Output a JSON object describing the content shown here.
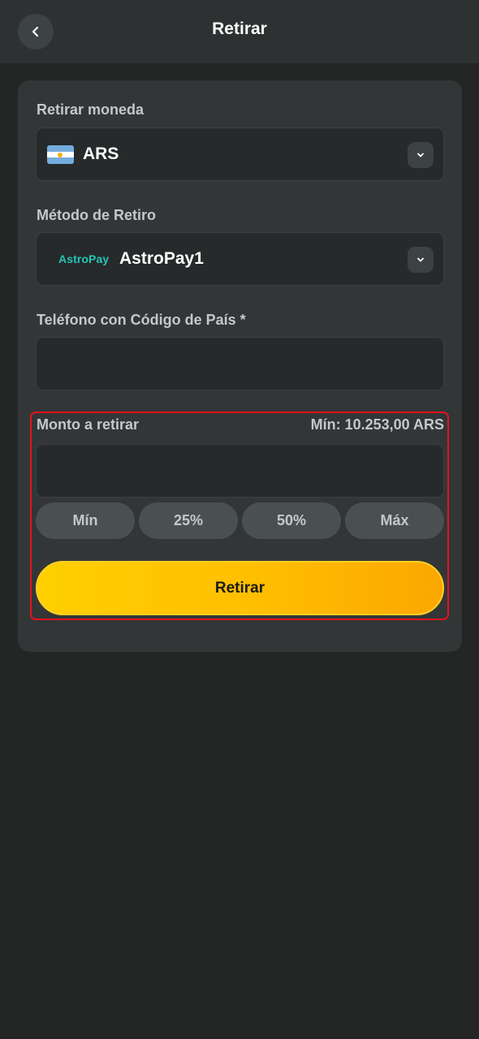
{
  "header": {
    "title": "Retirar",
    "back_icon": "chevron-left-icon"
  },
  "currency": {
    "label": "Retirar moneda",
    "value": "ARS",
    "flag_icon": "argentina-flag-icon"
  },
  "method": {
    "label": "Método de Retiro",
    "logo_text": "AstroPay",
    "value": "AstroPay1"
  },
  "phone": {
    "label": "Teléfono con Código de País *",
    "value": ""
  },
  "amount": {
    "label": "Monto a retirar",
    "min_text": "Mín: 10.253,00 ARS",
    "value": "",
    "quick_buttons": [
      "Mín",
      "25%",
      "50%",
      "Máx"
    ]
  },
  "submit_label": "Retirar",
  "colors": {
    "background": "#242626",
    "card": "#323637",
    "accent_yellow": "#ffc400",
    "highlight_red": "#e3121b",
    "astropay_teal": "#25c5b5"
  }
}
